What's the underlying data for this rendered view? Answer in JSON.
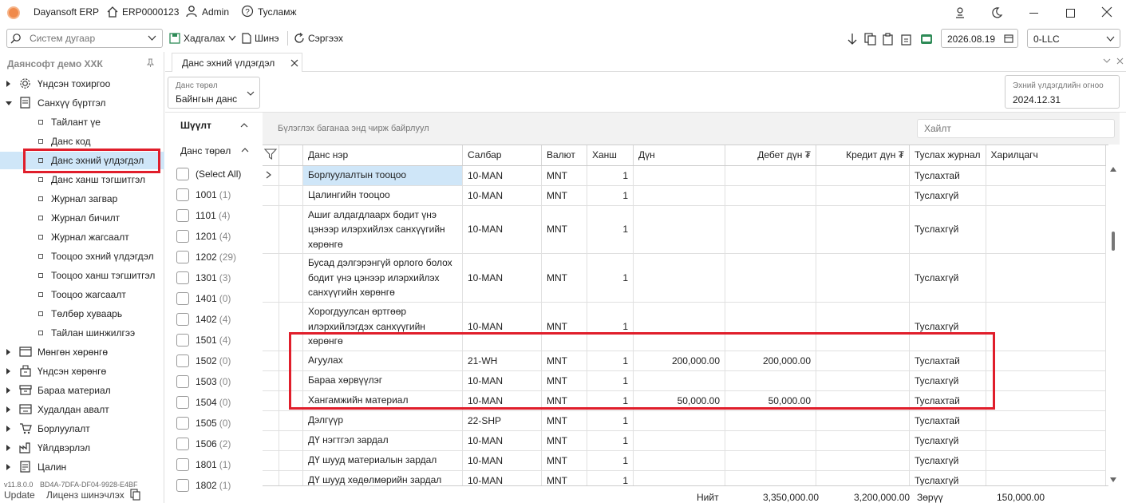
{
  "titlebar": {
    "app_name": "Dayansoft ERP",
    "company_code": "ERP0000123",
    "user": "Admin",
    "help": "Тусламж"
  },
  "toolbar": {
    "system_search_placeholder": "Систем дугаар",
    "save": "Хадгалах",
    "new": "Шинэ",
    "refresh": "Сэргээх",
    "date": "2026.08.19",
    "company_select": "0-LLC"
  },
  "sidebar": {
    "company": "Даянсофт демо ХХК",
    "groups": [
      {
        "label": "Үндсэн тохиргоо"
      },
      {
        "label": "Санхүү бүртгэл"
      },
      {
        "label": "Мөнгөн хөрөнгө"
      },
      {
        "label": "Үндсэн хөрөнгө"
      },
      {
        "label": "Бараа материал"
      },
      {
        "label": "Худалдан авалт"
      },
      {
        "label": "Борлуулалт"
      },
      {
        "label": "Үйлдвэрлэл"
      },
      {
        "label": "Цалин"
      }
    ],
    "finance_items": [
      "Тайлант үе",
      "Данс код",
      "Данс эхний үлдэгдэл",
      "Данс ханш тэгшитгэл",
      "Журнал загвар",
      "Журнал бичилт",
      "Журнал жагсаалт",
      "Тооцоо эхний үлдэгдэл",
      "Тооцоо ханш тэгшитгэл",
      "Тооцоо жагсаалт",
      "Төлбөр хуваарь",
      "Тайлан шинжилгээ"
    ],
    "version": "v11.8.0.0",
    "license_id": "BD4A-7DFA-DF04-9928-E4BF",
    "update": "Update",
    "license_copy": "Лиценз шинэчлэх"
  },
  "tab": {
    "label": "Данс эхний үлдэгдэл"
  },
  "account_type": {
    "label": "Данс төрөл",
    "value": "Байнгын данс"
  },
  "opening_date": {
    "label": "Эхний үлдэгдлийн огноо",
    "value": "2024.12.31"
  },
  "filter": {
    "title": "Шүүлт",
    "section": "Данс төрөл",
    "items": [
      {
        "label": "(Select All)",
        "count": ""
      },
      {
        "label": "1001",
        "count": "(1)"
      },
      {
        "label": "1101",
        "count": "(4)"
      },
      {
        "label": "1201",
        "count": "(4)"
      },
      {
        "label": "1202",
        "count": "(29)"
      },
      {
        "label": "1301",
        "count": "(3)"
      },
      {
        "label": "1401",
        "count": "(0)"
      },
      {
        "label": "1402",
        "count": "(4)"
      },
      {
        "label": "1501",
        "count": "(4)"
      },
      {
        "label": "1502",
        "count": "(0)"
      },
      {
        "label": "1503",
        "count": "(0)"
      },
      {
        "label": "1504",
        "count": "(0)"
      },
      {
        "label": "1505",
        "count": "(0)"
      },
      {
        "label": "1506",
        "count": "(2)"
      },
      {
        "label": "1801",
        "count": "(1)"
      },
      {
        "label": "1802",
        "count": "(1)"
      }
    ]
  },
  "group_panel": {
    "hint": "Бүлэглэх баганаа энд чирж байрлуул",
    "search_placeholder": "Хайлт"
  },
  "grid": {
    "columns": [
      "Данс нэр",
      "Салбар",
      "Валют",
      "Ханш",
      "Дүн",
      "Дебет дүн ₮",
      "Кредит дүн ₮",
      "Туслах журнал",
      "Харилцагч"
    ],
    "rows": [
      {
        "name": "Борлуулалтын тооцоо",
        "branch": "10-MAN",
        "cur": "MNT",
        "rate": "1",
        "amt": "",
        "debit": "",
        "credit": "",
        "journal": "Туслахтай"
      },
      {
        "name": "Цалингийн тооцоо",
        "branch": "10-MAN",
        "cur": "MNT",
        "rate": "1",
        "amt": "",
        "debit": "",
        "credit": "",
        "journal": "Туслахгүй"
      },
      {
        "name": "Ашиг алдагдлаарх бодит үнэ цэнээр илэрхийлэх санхүүгийн хөрөнгө",
        "branch": "10-MAN",
        "cur": "MNT",
        "rate": "1",
        "amt": "",
        "debit": "",
        "credit": "",
        "journal": "Туслахгүй"
      },
      {
        "name": "Бусад дэлгэрэнгүй орлого болох бодит үнэ цэнээр илэрхийлэх санхүүгийн хөрөнгө",
        "branch": "10-MAN",
        "cur": "MNT",
        "rate": "1",
        "amt": "",
        "debit": "",
        "credit": "",
        "journal": "Туслахгүй"
      },
      {
        "name": "Хорогдуулсан өртгөөр илэрхийлэгдэх санхүүгийн хөрөнгө",
        "branch": "10-MAN",
        "cur": "MNT",
        "rate": "1",
        "amt": "",
        "debit": "",
        "credit": "",
        "journal": "Туслахгүй"
      },
      {
        "name": "Агуулах",
        "branch": "21-WH",
        "cur": "MNT",
        "rate": "1",
        "amt": "200,000.00",
        "debit": "200,000.00",
        "credit": "",
        "journal": "Туслахтай"
      },
      {
        "name": "Бараа хөрвүүлэг",
        "branch": "10-MAN",
        "cur": "MNT",
        "rate": "1",
        "amt": "",
        "debit": "",
        "credit": "",
        "journal": "Туслахгүй"
      },
      {
        "name": "Хангамжийн материал",
        "branch": "10-MAN",
        "cur": "MNT",
        "rate": "1",
        "amt": "50,000.00",
        "debit": "50,000.00",
        "credit": "",
        "journal": "Туслахтай"
      },
      {
        "name": "Дэлгүүр",
        "branch": "22-SHP",
        "cur": "MNT",
        "rate": "1",
        "amt": "",
        "debit": "",
        "credit": "",
        "journal": "Туслахтай"
      },
      {
        "name": "ДҮ нэгтгэл зардал",
        "branch": "10-MAN",
        "cur": "MNT",
        "rate": "1",
        "amt": "",
        "debit": "",
        "credit": "",
        "journal": "Туслахгүй"
      },
      {
        "name": "ДҮ шууд материалын зардал",
        "branch": "10-MAN",
        "cur": "MNT",
        "rate": "1",
        "amt": "",
        "debit": "",
        "credit": "",
        "journal": "Туслахгүй"
      },
      {
        "name": "ДҮ шууд хөдөлмөрийн зардал",
        "branch": "10-MAN",
        "cur": "MNT",
        "rate": "1",
        "amt": "",
        "debit": "",
        "credit": "",
        "journal": "Туслахгүй"
      }
    ],
    "footer": {
      "label": "Нийт",
      "amt": "3,350,000.00",
      "debit": "3,200,000.00",
      "journal": "Зөрүү",
      "partner": "150,000.00"
    }
  }
}
